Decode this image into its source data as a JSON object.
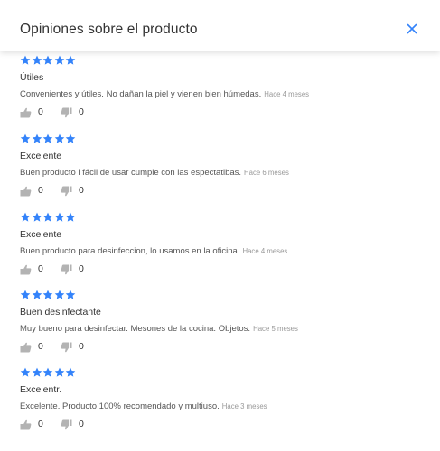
{
  "modal": {
    "title": "Opiniones sobre el producto",
    "close_icon": "close-icon",
    "accent_color": "#3483fa"
  },
  "reviews": [
    {
      "rating": 5,
      "title": "Útiles",
      "text": "Convenientes y útiles. No dañan la piel y vienen bien húmedas.",
      "date": "Hace 4 meses",
      "likes": "0",
      "dislikes": "0"
    },
    {
      "rating": 5,
      "title": "Excelente",
      "text": "Buen producto i fácil de usar cumple con las espectatibas.",
      "date": "Hace 6 meses",
      "likes": "0",
      "dislikes": "0"
    },
    {
      "rating": 5,
      "title": "Excelente",
      "text": "Buen producto para desinfeccion, lo usamos en la oficina.",
      "date": "Hace 4 meses",
      "likes": "0",
      "dislikes": "0"
    },
    {
      "rating": 5,
      "title": "Buen desinfectante",
      "text": "Muy bueno para desinfectar. Mesones de la cocina. Objetos.",
      "date": "Hace 5 meses",
      "likes": "0",
      "dislikes": "0"
    },
    {
      "rating": 5,
      "title": "Excelentr.",
      "text": "Excelente. Producto 100% recomendado y multiuso.",
      "date": "Hace 3 meses",
      "likes": "0",
      "dislikes": "0"
    }
  ]
}
